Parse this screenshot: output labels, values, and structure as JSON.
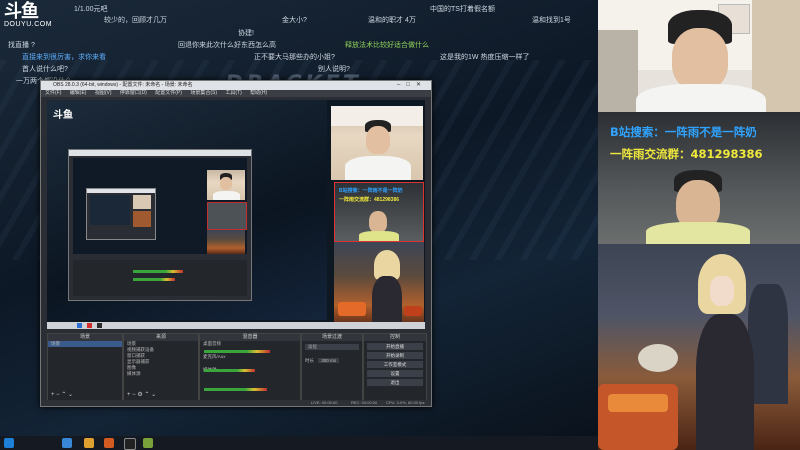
{
  "logo": {
    "mark": "斗鱼",
    "sub": "DOUYU.COM"
  },
  "danmaku": [
    {
      "text": "1/1.00元吧",
      "color": "#cfd8e3"
    },
    {
      "text": "较少的，回顾才几万",
      "color": "#cfd8e3"
    },
    {
      "text": "金大小?",
      "color": "#cfd8e3"
    },
    {
      "text": "中国的TS打着假名额",
      "color": "#cfd8e3"
    },
    {
      "text": "温和的职才 4万",
      "color": "#cfd8e3"
    },
    {
      "text": "温和找到1号",
      "color": "#cfd8e3"
    },
    {
      "text": "协建!",
      "color": "#cfd8e3"
    },
    {
      "text": "回退你来此次什么好东西怎么高",
      "color": "#cfd8e3"
    },
    {
      "text": "释放法术比较好适合做什么",
      "color": "#8fd35a"
    },
    {
      "text": "找直播 ?",
      "color": "#cfd8e3"
    },
    {
      "text": "直接来到很厉害，求你来看",
      "color": "#5fb0ff"
    },
    {
      "text": "正不要大马那些办的小姐?",
      "color": "#cfd8e3"
    },
    {
      "text": "这是我的1W 热度压缩一样了",
      "color": "#cfd8e3"
    },
    {
      "text": "首人说什么吧?",
      "color": "#cfd8e3"
    },
    {
      "text": "别人说明?",
      "color": "#cfd8e3"
    },
    {
      "text": "一万两个都没什么",
      "color": "#cfd8e3"
    }
  ],
  "bigtitle": "DRACKET",
  "obs": {
    "title": "OBS 28.0.3 (64-bit, windows) - 配置文件: 未命名 - 场景: 未命名",
    "menu": [
      "文件(F)",
      "编辑(E)",
      "视图(V)",
      "停靠窗口(D)",
      "配置文件(P)",
      "场景集合(S)",
      "工具(T)",
      "帮助(H)"
    ],
    "docks": {
      "scenes": {
        "title": "场景",
        "items": [
          "场景"
        ]
      },
      "sources": {
        "title": "来源",
        "items": [
          "场景",
          "视频捕获设备",
          "窗口捕获",
          "显示器捕获",
          "图像",
          "媒体源"
        ]
      },
      "mixer": {
        "title": "混音器",
        "items": [
          "桌面音频",
          "麦克风/Aux",
          "媒体源"
        ],
        "levels": [
          0.72,
          0.55,
          0.68
        ]
      },
      "transitions": {
        "title": "场景过渡",
        "type": "淡化",
        "duration_label": "时长",
        "duration": "300 ms"
      },
      "controls": {
        "title": "控制",
        "buttons": [
          "开始直播",
          "开始录制",
          "工作室模式",
          "设置",
          "退出"
        ]
      }
    },
    "status": {
      "live": "LIVE: 00:00:00",
      "rec": "REC: 00:00:00",
      "cpu": "CPU: 3.0%, 60.00 fps"
    }
  },
  "promo": {
    "line1": "B站搜索：一阵雨不是一阵奶",
    "line2": "一阵雨交流群：481298386"
  },
  "taskbar": {
    "icons": [
      "windows-icon",
      "search-icon",
      "file-explorer-icon",
      "obs-icon",
      "chrome-icon",
      "browser-icon",
      "chat-icon"
    ]
  }
}
